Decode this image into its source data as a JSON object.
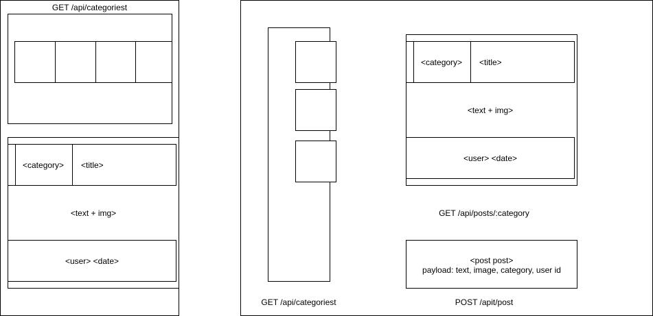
{
  "left_panel": {
    "categories_label": "GET /api/categoriest",
    "post_card": {
      "category": "<category>",
      "title": "<title>",
      "body": "<text + img>",
      "footer": "<user> <date>"
    }
  },
  "right_panel": {
    "sidebar_label": "GET /api/categoriest",
    "post_card": {
      "category": "<category>",
      "title": "<title>",
      "body": "<text + img>",
      "footer": "<user> <date>"
    },
    "posts_label": "GET /api/posts/:category",
    "create_post": {
      "line1": "<post post>",
      "line2": "payload: text, image, category, user id"
    },
    "create_label": "POST /apit/post"
  }
}
